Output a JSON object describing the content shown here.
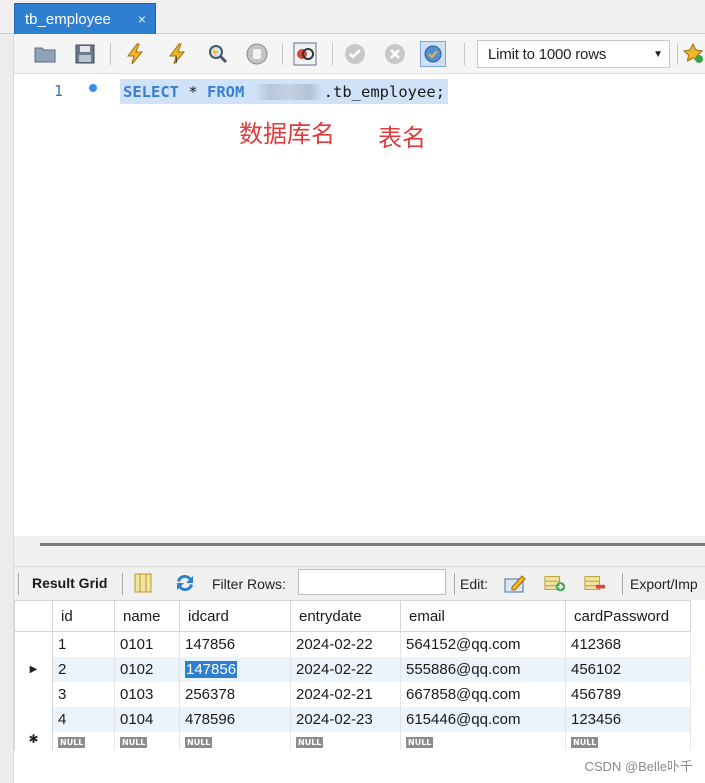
{
  "tab": {
    "label": "tb_employee",
    "close_glyph": "×"
  },
  "toolbar": {
    "limit_label": "Limit to 1000 rows",
    "icons": [
      "folder-open-icon",
      "save-icon",
      "execute-icon",
      "execute-current-icon",
      "explain-icon",
      "stop-icon",
      "toggle-error-icon",
      "commit-icon",
      "rollback-icon",
      "autocommit-icon",
      "beautify-icon"
    ]
  },
  "editor": {
    "line_number": "1",
    "sql": {
      "select": "SELECT",
      "star": " * ",
      "from": "FROM",
      "table": ".tb_employee;"
    },
    "annotation_db": "数据库名",
    "annotation_table": "表名"
  },
  "result": {
    "grid_label": "Result Grid",
    "filter_label": "Filter Rows:",
    "filter_value": "",
    "edit_label": "Edit:",
    "export_label": "Export/Imp"
  },
  "grid": {
    "columns": [
      "id",
      "name",
      "idcard",
      "entrydate",
      "email",
      "cardPassword"
    ],
    "rows": [
      [
        "1",
        "0101",
        "147856",
        "2024-02-22",
        "564152@qq.com",
        "412368"
      ],
      [
        "2",
        "0102",
        "147856",
        "2024-02-22",
        "555886@qq.com",
        "456102"
      ],
      [
        "3",
        "0103",
        "256378",
        "2024-02-21",
        "667858@qq.com",
        "456789"
      ],
      [
        "4",
        "0104",
        "478596",
        "2024-02-23",
        "615446@qq.com",
        "123456"
      ]
    ],
    "current_row_marker": "▶",
    "new_row_marker": "✱",
    "null_text": "NULL"
  },
  "watermark": "CSDN @Belle卟千"
}
